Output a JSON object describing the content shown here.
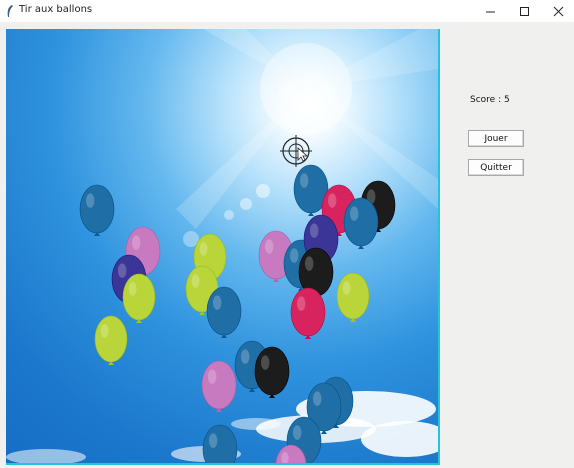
{
  "window": {
    "title": "Tir aux ballons",
    "controls": [
      "minimize",
      "maximize",
      "close"
    ]
  },
  "game": {
    "background": "sky-with-sun",
    "crosshair": "crosshair-icon",
    "balloon_colors": {
      "blue": "#1f6ea6",
      "pink": "#c77ac0",
      "lime": "#b9d53a",
      "black": "#1c1c1c",
      "purple": "#3a3596",
      "red": "#d8245e"
    },
    "balloons": [
      {
        "color": "blue"
      },
      {
        "color": "pink"
      },
      {
        "color": "lime"
      },
      {
        "color": "purple"
      },
      {
        "color": "lime"
      },
      {
        "color": "lime"
      },
      {
        "color": "lime"
      },
      {
        "color": "blue"
      },
      {
        "color": "pink"
      },
      {
        "color": "blue"
      },
      {
        "color": "blue"
      },
      {
        "color": "red"
      },
      {
        "color": "black"
      },
      {
        "color": "blue"
      },
      {
        "color": "purple"
      },
      {
        "color": "black"
      },
      {
        "color": "red"
      },
      {
        "color": "lime"
      },
      {
        "color": "blue"
      },
      {
        "color": "black"
      },
      {
        "color": "pink"
      },
      {
        "color": "blue"
      },
      {
        "color": "blue"
      },
      {
        "color": "blue"
      },
      {
        "color": "blue"
      },
      {
        "color": "pink"
      }
    ]
  },
  "panel": {
    "score_text": "Score : 5",
    "play_label": "Jouer",
    "quit_label": "Quitter"
  }
}
